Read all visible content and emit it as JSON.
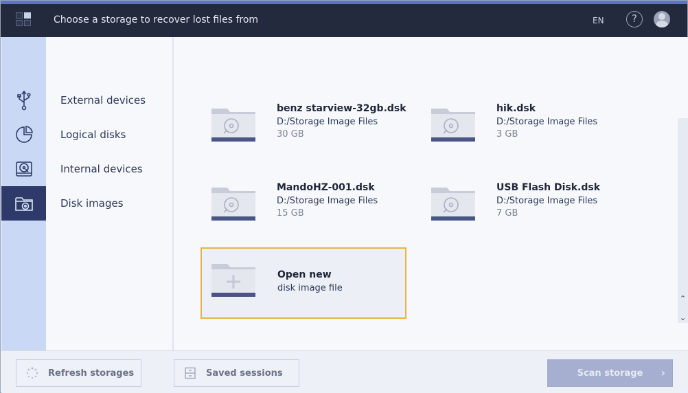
{
  "header": {
    "title": "Choose a storage to recover lost files from",
    "lang": "EN",
    "help_glyph": "?"
  },
  "categories": [
    {
      "label": "External devices",
      "icon": "usb-icon"
    },
    {
      "label": "Logical disks",
      "icon": "pie-disk-icon"
    },
    {
      "label": "Internal devices",
      "icon": "hard-drive-icon"
    },
    {
      "label": "Disk images",
      "icon": "disk-image-folder-icon",
      "active": true
    }
  ],
  "images": [
    {
      "name": "benz starview-32gb.dsk",
      "path": "D:/Storage Image Files",
      "size": "30 GB"
    },
    {
      "name": "hik.dsk",
      "path": "D:/Storage Image Files",
      "size": "3 GB"
    },
    {
      "name": "MandoHZ-001.dsk",
      "path": "D:/Storage Image Files",
      "size": "15 GB"
    },
    {
      "name": "USB Flash Disk.dsk",
      "path": "D:/Storage Image Files",
      "size": "7 GB"
    }
  ],
  "open_new": {
    "title": "Open new",
    "subtitle": "disk image file"
  },
  "footer": {
    "refresh_label": "Refresh storages",
    "sessions_label": "Saved sessions",
    "scan_label": "Scan storage"
  },
  "colors": {
    "accent": "#5b73c8",
    "header_bg": "#232a3e",
    "rail_bg": "#c9d9f5",
    "rail_active": "#2d3a6a",
    "selection_border": "#e6b44a"
  }
}
